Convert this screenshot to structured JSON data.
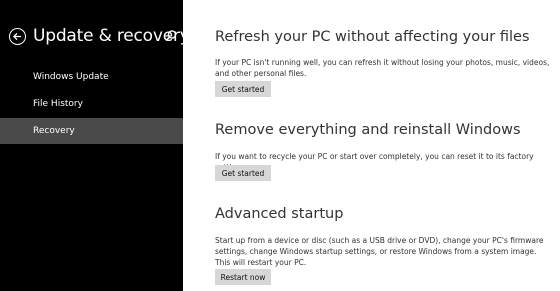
{
  "sidebar": {
    "title": "Update & recovery",
    "items": [
      {
        "label": "Windows Update",
        "selected": false
      },
      {
        "label": "File History",
        "selected": false
      },
      {
        "label": "Recovery",
        "selected": true
      }
    ]
  },
  "sections": [
    {
      "heading": "Refresh your PC without affecting your files",
      "description": "If your PC isn't running well, you can refresh it without losing your photos, music, videos, and other personal files.",
      "button": "Get started"
    },
    {
      "heading": "Remove everything and reinstall Windows",
      "description": "If you want to recycle your PC or start over completely, you can reset it to its factory settings.",
      "button": "Get started"
    },
    {
      "heading": "Advanced startup",
      "description": "Start up from a device or disc (such as a USB drive or DVD), change your PC's firmware settings, change Windows startup settings, or restore Windows from a system image. This will restart your PC.",
      "button": "Restart now"
    }
  ],
  "icons": {
    "back": "back-arrow-icon",
    "search": "search-icon"
  },
  "colors": {
    "sidebar_bg": "#000000",
    "selected_item": "#4a4a4a",
    "button_bg": "#d7d7d7"
  }
}
